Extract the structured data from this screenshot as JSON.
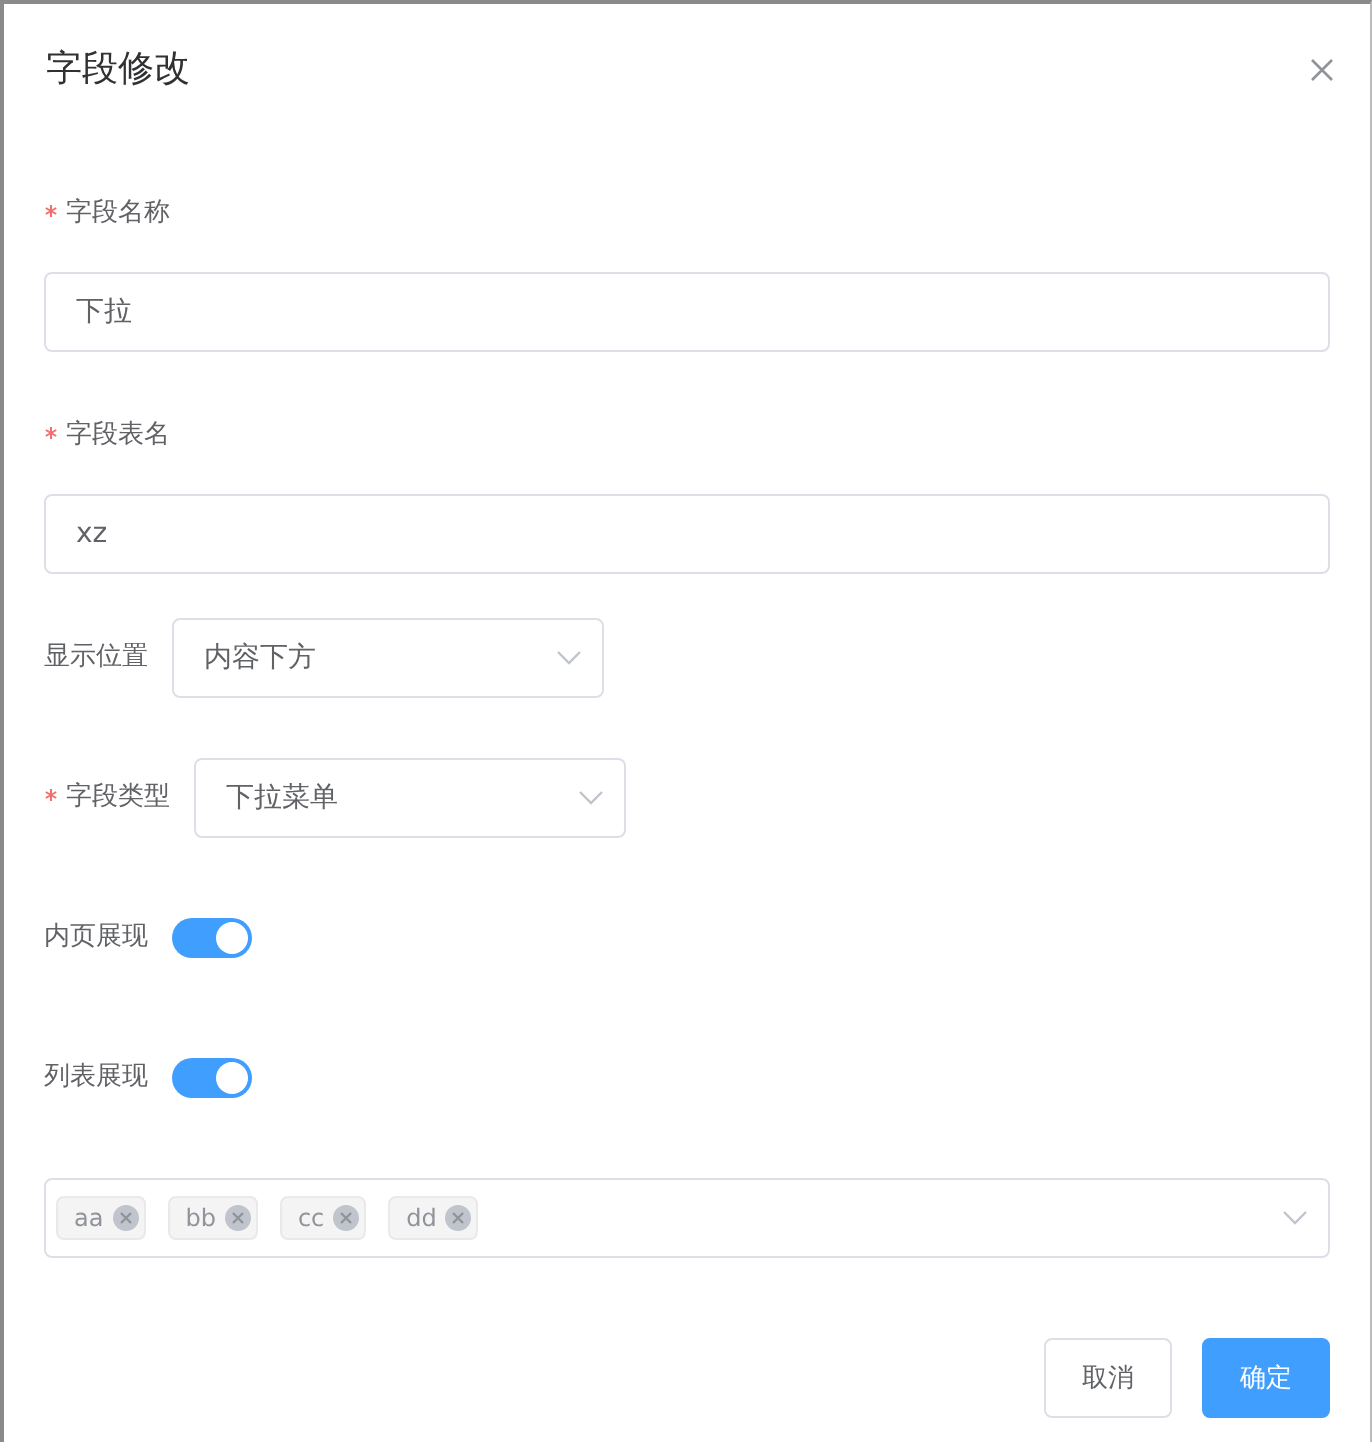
{
  "dialog": {
    "title": "字段修改"
  },
  "fields": [
    {
      "kind": "text",
      "label": "字段名称",
      "required": true,
      "value": "下拉"
    },
    {
      "kind": "text",
      "label": "字段表名",
      "required": true,
      "value": "xz"
    },
    {
      "kind": "select",
      "label": "显示位置",
      "required": false,
      "value": "内容下方"
    },
    {
      "kind": "select",
      "label": "字段类型",
      "required": true,
      "value": "下拉菜单"
    },
    {
      "kind": "switch",
      "label": "内页展现",
      "required": false,
      "on": true
    },
    {
      "kind": "switch",
      "label": "列表展现",
      "required": false,
      "on": true
    },
    {
      "kind": "tags",
      "tags": [
        "aa",
        "bb",
        "cc",
        "dd"
      ]
    }
  ],
  "buttons": [
    {
      "label": "取消",
      "primary": false
    },
    {
      "label": "确定",
      "primary": true
    }
  ]
}
